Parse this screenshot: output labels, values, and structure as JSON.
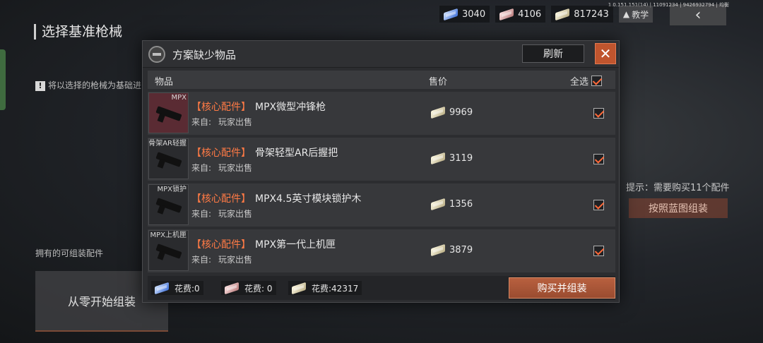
{
  "background": {
    "page_title": "选择基准枪械",
    "note": "将以选择的枪械为基础进",
    "owned_parts_label": "拥有的可组装配件",
    "start_from_scratch": "从零开始组装",
    "hint": "提示：需要购买11个配件",
    "blueprint_button": "按照蓝图组装",
    "back_icon": "‹",
    "version": "1.0.151.151(14) | 11091234 | 9426932794 | 均衡"
  },
  "currency": [
    {
      "icon": "blue-bill-icon",
      "value": "3040",
      "color": "#3d6fd8"
    },
    {
      "icon": "red-bill-icon",
      "value": "4106",
      "color": "#b87a7a"
    },
    {
      "icon": "gold-bill-icon",
      "value": "817243",
      "color": "#b9ad84"
    }
  ],
  "tutorial_label": "教学",
  "dialog": {
    "title": "方案缺少物品",
    "refresh_label": "刷新",
    "close_symbol": "✕",
    "columns": {
      "item": "物品",
      "price": "售价",
      "select_all": "全选"
    },
    "rows": [
      {
        "thumb_label": "MPX",
        "tag": "【核心配件】",
        "name": "MPX微型冲锋枪",
        "source_label": "来自:",
        "source": "玩家出售",
        "price": "9969",
        "checked": true
      },
      {
        "thumb_label": "骨架AR轻握",
        "tag": "【核心配件】",
        "name": "骨架轻型AR后握把",
        "source_label": "来自:",
        "source": "玩家出售",
        "price": "3119",
        "checked": true
      },
      {
        "thumb_label": "MPX锁护",
        "tag": "【核心配件】",
        "name": "MPX4.5英寸模块锁护木",
        "source_label": "来自:",
        "source": "玩家出售",
        "price": "1356",
        "checked": true
      },
      {
        "thumb_label": "MPX上机匣",
        "tag": "【核心配件】",
        "name": "MPX第一代上机匣",
        "source_label": "来自:",
        "source": "玩家出售",
        "price": "3879",
        "checked": true
      }
    ],
    "costs": [
      {
        "icon": "blue-bill-icon",
        "label": "花费:0"
      },
      {
        "icon": "red-bill-icon",
        "label": "花费: 0"
      },
      {
        "icon": "gold-bill-icon",
        "label": "花费:42317"
      }
    ],
    "buy_button": "购买并组装"
  }
}
